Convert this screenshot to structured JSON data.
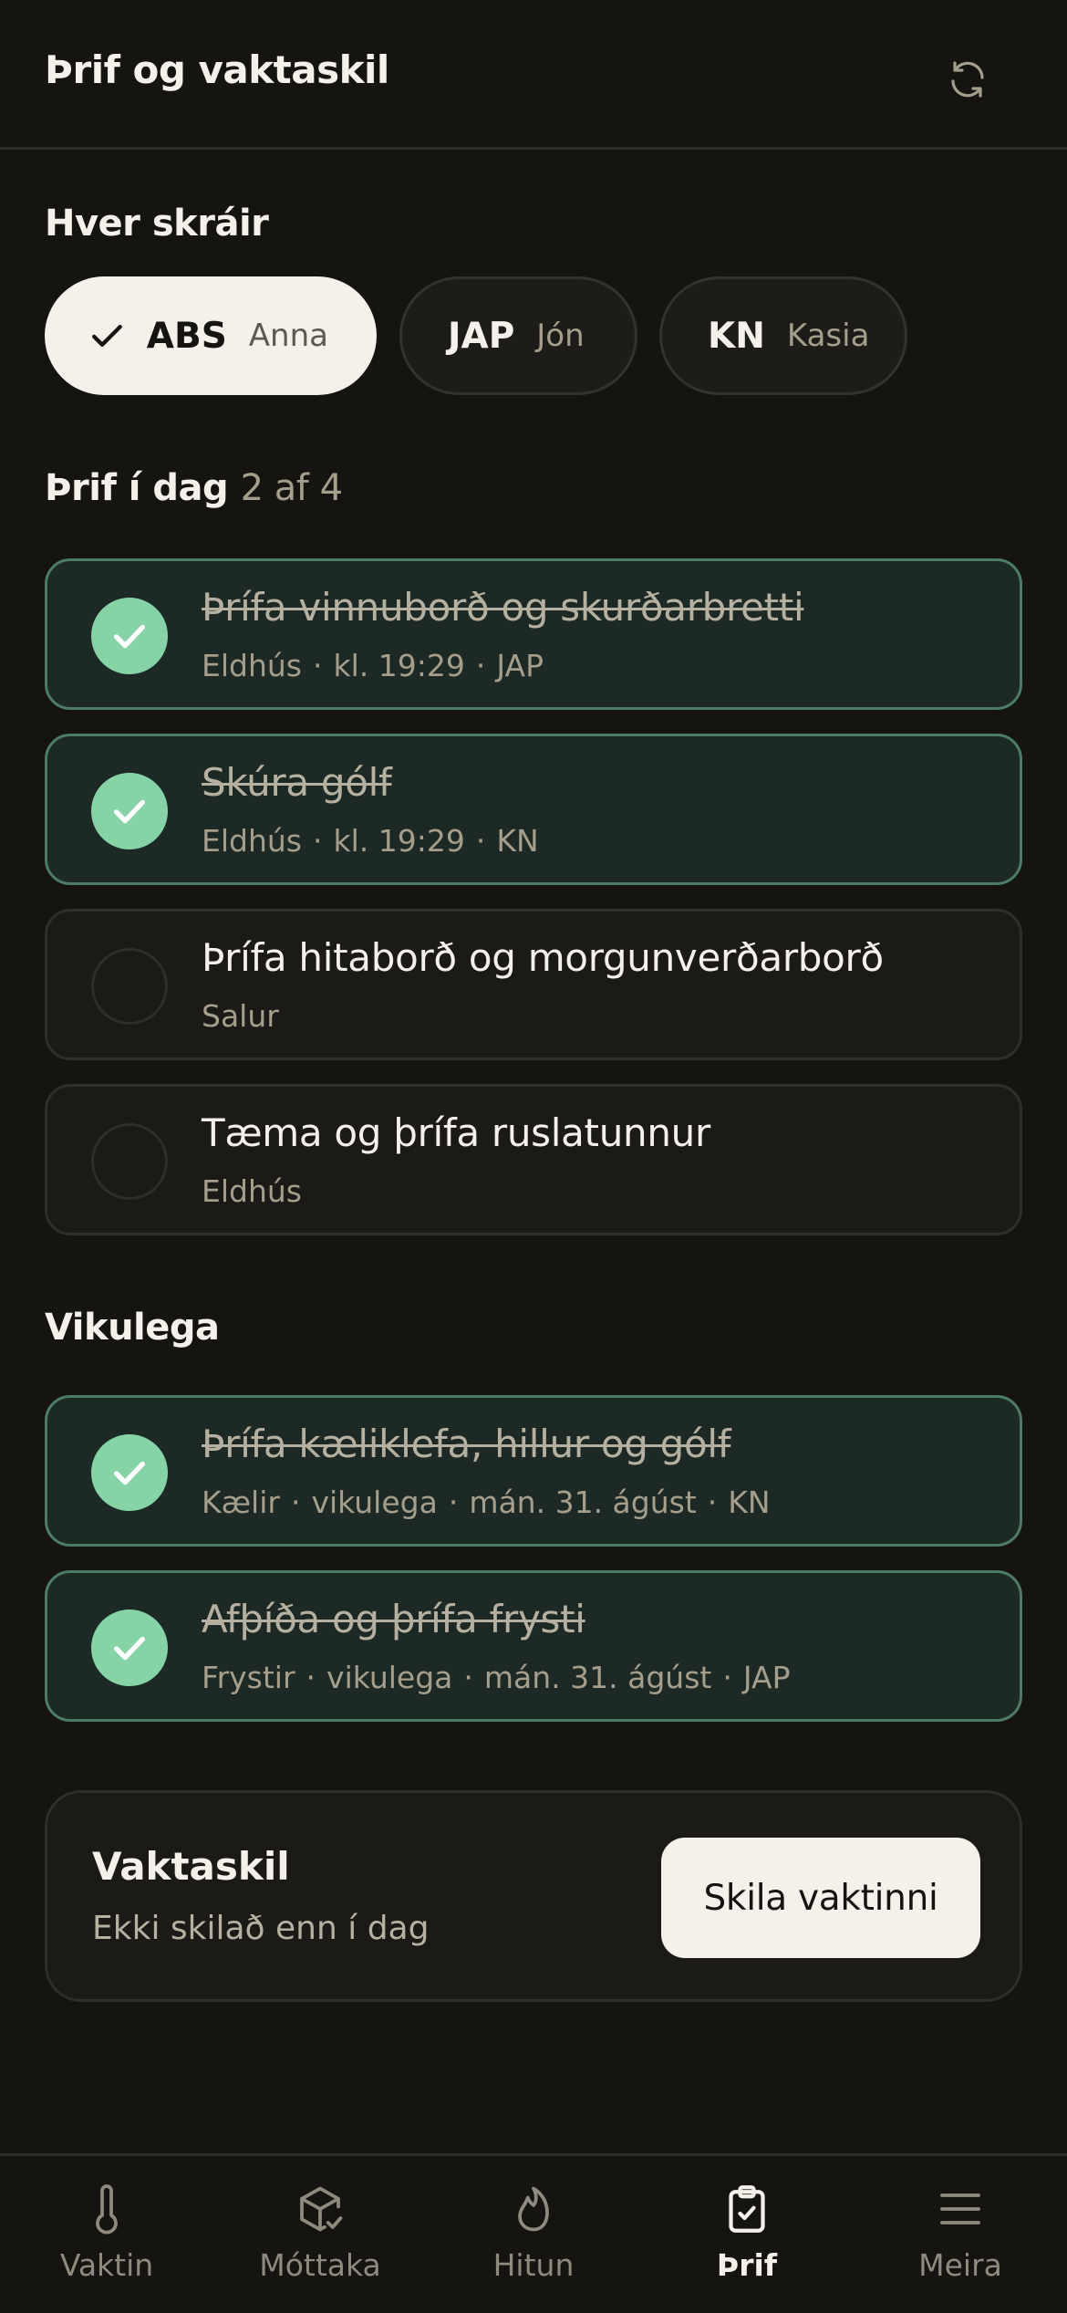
{
  "header": {
    "title": "Þrif og vaktaskil",
    "refresh_icon": "refresh-icon"
  },
  "who": {
    "label": "Hver skráir",
    "people": [
      {
        "code": "ABS",
        "name": "Anna",
        "selected": true
      },
      {
        "code": "JAP",
        "name": "Jón",
        "selected": false
      },
      {
        "code": "KN",
        "name": "Kasia",
        "selected": false
      }
    ]
  },
  "today": {
    "title": "Þrif í dag",
    "count": "2 af 4",
    "tasks": [
      {
        "title": "Þrífa vinnuborð og skurðarbretti",
        "done": true,
        "meta": [
          "Eldhús",
          "kl. 19:29",
          "JAP"
        ]
      },
      {
        "title": "Skúra gólf",
        "done": true,
        "meta": [
          "Eldhús",
          "kl. 19:29",
          "KN"
        ]
      },
      {
        "title": "Þrífa hitaborð og morgunverðarborð",
        "done": false,
        "meta": [
          "Salur"
        ]
      },
      {
        "title": "Tæma og þrífa ruslatunnur",
        "done": false,
        "meta": [
          "Eldhús"
        ]
      }
    ]
  },
  "weekly": {
    "title": "Vikulega",
    "tasks": [
      {
        "title": "Þrífa kæliklefa, hillur og gólf",
        "done": true,
        "meta": [
          "Kælir",
          "vikulega",
          "mán. 31. ágúst",
          "KN"
        ]
      },
      {
        "title": "Afþíða og þrífa frysti",
        "done": true,
        "meta": [
          "Frystir",
          "vikulega",
          "mán. 31. ágúst",
          "JAP"
        ]
      }
    ]
  },
  "handoff": {
    "title": "Vaktaskil",
    "status": "Ekki skilað enn í dag",
    "button": "Skila vaktinni"
  },
  "tabs": [
    {
      "label": "Vaktin",
      "icon": "thermometer-icon",
      "active": false
    },
    {
      "label": "Móttaka",
      "icon": "package-check-icon",
      "active": false
    },
    {
      "label": "Hitun",
      "icon": "flame-icon",
      "active": false
    },
    {
      "label": "Þrif",
      "icon": "clipboard-check-icon",
      "active": true
    },
    {
      "label": "Meira",
      "icon": "menu-icon",
      "active": false
    }
  ],
  "colors": {
    "background": "#151411",
    "accent": "#86d3a6",
    "done_card": "#1d2925",
    "done_border": "#4c7c66"
  }
}
